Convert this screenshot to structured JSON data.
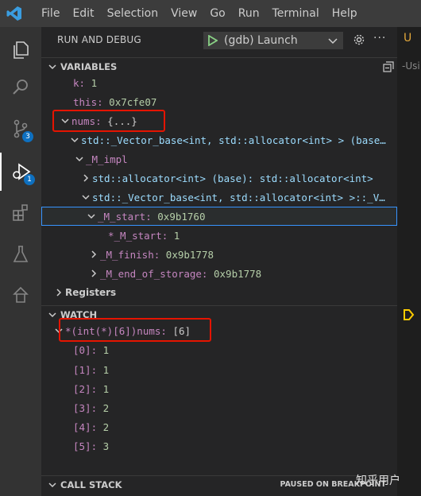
{
  "menu": [
    "File",
    "Edit",
    "Selection",
    "View",
    "Go",
    "Run",
    "Terminal",
    "Help"
  ],
  "activity_bar": {
    "source_control_badge": "3",
    "debug_badge": "1"
  },
  "run": {
    "title": "RUN AND DEBUG",
    "config": "(gdb) Launch"
  },
  "variables": {
    "header": "VARIABLES",
    "rows": {
      "k_name": "k:",
      "k_value": "1",
      "this_name": "this:",
      "this_value": "0x7cfe07",
      "nums_name": "nums:",
      "nums_value": "{...}",
      "vector_base": "std::_Vector_base<int, std::allocator<int> > (base…",
      "m_impl": "_M_impl",
      "allocator": "std::allocator<int> (base): std::allocator<int>",
      "vector_impl": "std::_Vector_base<int, std::allocator<int> >::_V…",
      "m_start_name": "_M_start:",
      "m_start_value": "0x9b1760",
      "deref_m_start_name": "*_M_start:",
      "deref_m_start_value": "1",
      "m_finish_name": "_M_finish:",
      "m_finish_value": "0x9b1778",
      "m_end_name": "_M_end_of_storage:",
      "m_end_value": "0x9b1778"
    },
    "registers": "Registers"
  },
  "watch": {
    "header": "WATCH",
    "expression": "*(int(*)[6])nums:",
    "expression_value": "[6]",
    "items": [
      {
        "index": "[0]:",
        "value": "1"
      },
      {
        "index": "[1]:",
        "value": "1"
      },
      {
        "index": "[2]:",
        "value": "1"
      },
      {
        "index": "[3]:",
        "value": "2"
      },
      {
        "index": "[4]:",
        "value": "2"
      },
      {
        "index": "[5]:",
        "value": "3"
      }
    ]
  },
  "call_stack": {
    "header": "CALL STACK",
    "status": "PAUSED ON BREAKPOINT"
  },
  "editor_edge": {
    "letter": "U",
    "text": "-Usi"
  },
  "watermark": "知乎用户",
  "colors": {
    "highlight": "#e51400",
    "selection_border": "#3794ff",
    "badge": "#0e70c0",
    "play": "#89d185"
  }
}
